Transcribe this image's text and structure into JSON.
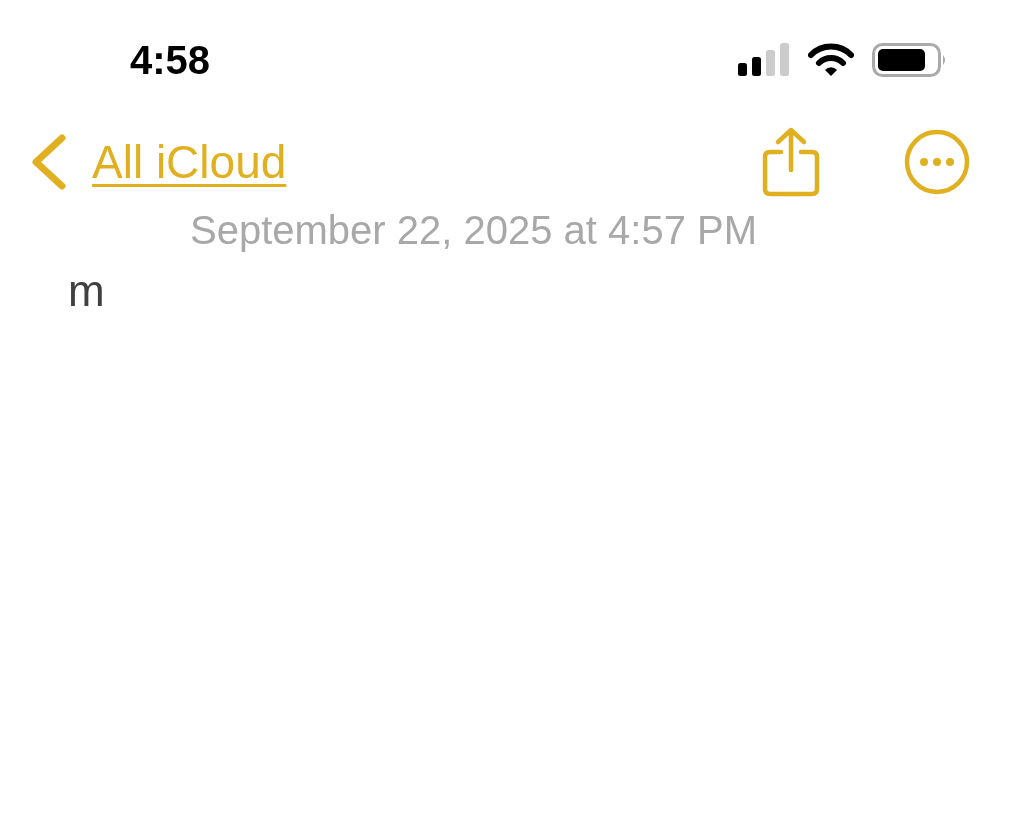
{
  "status_bar": {
    "time": "4:58"
  },
  "nav": {
    "back_label": "All iCloud"
  },
  "note": {
    "date": "September 22, 2025 at 4:57 PM",
    "body": "m"
  }
}
